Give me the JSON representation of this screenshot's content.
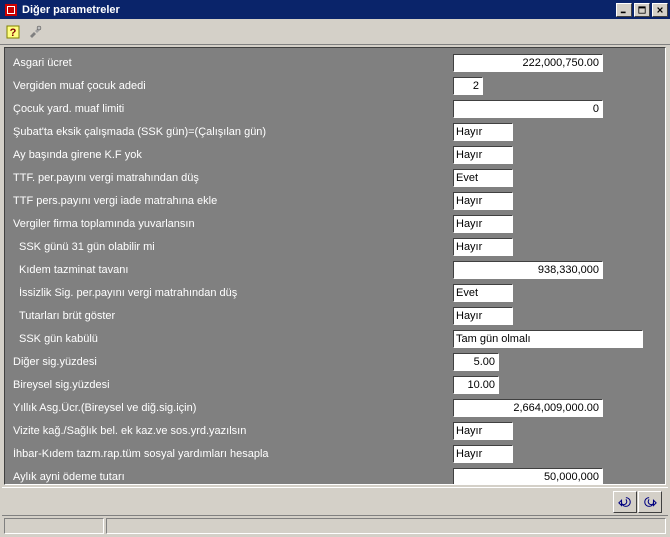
{
  "window": {
    "title": "Diğer parametreler"
  },
  "toolbar": {
    "help_icon": "?",
    "tools_icon": "tools"
  },
  "fields": {
    "asgari_ucret": {
      "label": "Asgari ücret",
      "value": "222,000,750.00"
    },
    "vergiden_muaf_cocuk": {
      "label": "Vergiden muaf çocuk adedi",
      "value": "2"
    },
    "cocuk_yard_limit": {
      "label": "Çocuk yard. muaf limiti",
      "value": "0"
    },
    "subat_eksik": {
      "label": "Şubat'ta eksik çalışmada (SSK gün)=(Çalışılan gün)",
      "value": "Hayır"
    },
    "ay_basinda_kf": {
      "label": "Ay başında girene K.F yok",
      "value": "Hayır"
    },
    "ttf_per_vergi_matrah": {
      "label": "TTF. per.payını vergi matrahından düş",
      "value": "Evet"
    },
    "ttf_pers_vergi_iade": {
      "label": "TTF pers.payını vergi iade matrahına ekle",
      "value": "Hayır"
    },
    "vergiler_yuvarlansin": {
      "label": "Vergiler firma toplamında yuvarlansın",
      "value": "Hayır"
    },
    "ssk_31": {
      "label": "SSK günü 31 gün olabilir mi",
      "value": "Hayır"
    },
    "kidem_tavan": {
      "label": "Kıdem tazminat tavanı",
      "value": "938,330,000"
    },
    "issizlik_vergi_matrah": {
      "label": "İssizlik Sig. per.payını vergi matrahından düş",
      "value": "Evet"
    },
    "tutar_brut": {
      "label": "Tutarları brüt göster",
      "value": "Hayır"
    },
    "ssk_gun_kabulu": {
      "label": "SSK gün kabülü",
      "value": "Tam gün olmalı"
    },
    "diger_sig_yuzde": {
      "label": "Diğer sig.yüzdesi",
      "value": "5.00"
    },
    "bireysel_sig_yuzde": {
      "label": "Bireysel sig.yüzdesi",
      "value": "10.00"
    },
    "yillik_asg_ucr": {
      "label": "Yıllık Asg.Ücr.(Bireysel ve diğ.sig.için)",
      "value": "2,664,009,000.00"
    },
    "vizite_kag": {
      "label": "Vizite kağ./Sağlık bel. ek kaz.ve sos.yrd.yazılsın",
      "value": "Hayır"
    },
    "ihbar_kidem": {
      "label": "İhbar-Kıdem tazm.rap.tüm sosyal yardımları hesapla",
      "value": "Hayır"
    },
    "aylik_ayni": {
      "label": "Aylık ayni ödeme tutarı",
      "value": "50,000,000"
    }
  },
  "buttons": {
    "undo": "undo",
    "redo": "redo"
  }
}
